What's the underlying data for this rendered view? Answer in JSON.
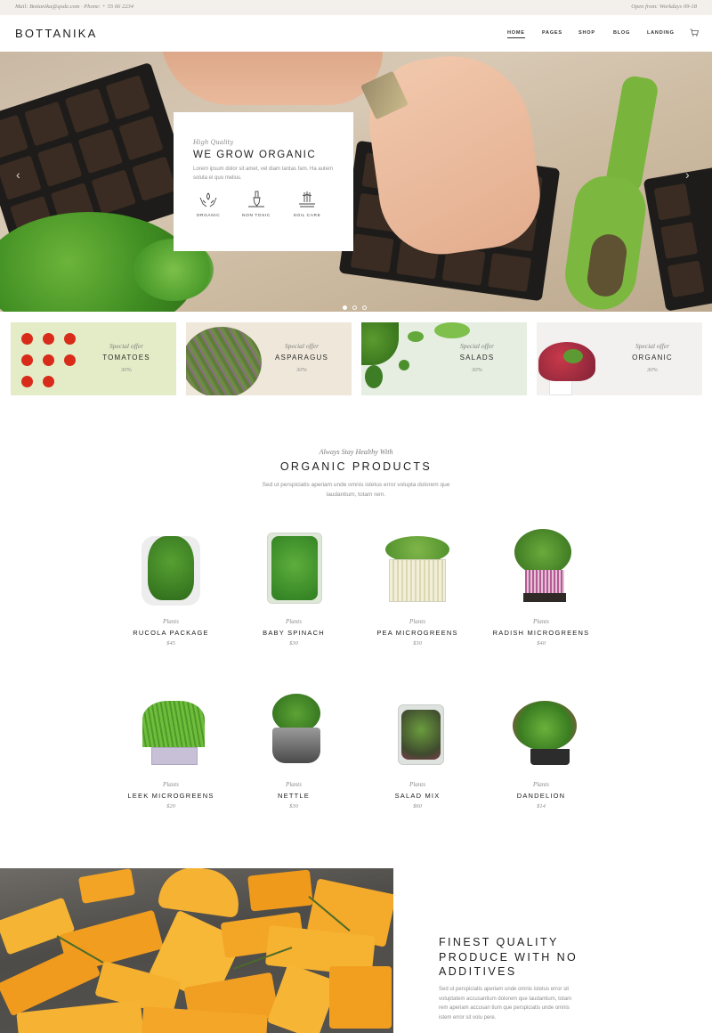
{
  "topbar": {
    "contact": "Mail: Bottanika@qode.com · Phone: + 55 66 2234",
    "hours": "Open from: Workdays 09-18"
  },
  "header": {
    "logo": "BOTTANIKA",
    "nav": [
      "HOME",
      "PAGES",
      "SHOP",
      "BLOG",
      "LANDING"
    ],
    "active_nav": "HOME",
    "cart_icon": "cart-icon"
  },
  "hero": {
    "kicker": "High Quality",
    "title": "WE GROW ORGANIC",
    "description": "Lorem ipsum dolor sit amet, vel diam tantas fam. Ha autem soluta ei quo melius.",
    "features": [
      {
        "label": "ORGANIC",
        "icon": "hands-leaf-icon"
      },
      {
        "label": "NON TOXIC",
        "icon": "shovel-icon"
      },
      {
        "label": "SOIL CARE",
        "icon": "wheat-icon"
      }
    ],
    "slider_count": 3,
    "active_slide": 1
  },
  "offers": [
    {
      "kicker": "Special offer",
      "name": "TOMATOES",
      "percent": "30%",
      "bg": "#e3ecc6"
    },
    {
      "kicker": "Special offer",
      "name": "ASPARAGUS",
      "percent": "30%",
      "bg": "#efe8da"
    },
    {
      "kicker": "Special offer",
      "name": "SALADS",
      "percent": "30%",
      "bg": "#e5eee0"
    },
    {
      "kicker": "Special offer",
      "name": "ORGANIC",
      "percent": "30%",
      "bg": "#f3f1f0"
    }
  ],
  "section": {
    "kicker": "Always Stay Healthy With",
    "title": "ORGANIC PRODUCTS",
    "description": "Sed ut perspiciatis aperiam unde omnis istetus error volupta dolorem que laudantium, totam rem."
  },
  "products": [
    {
      "category": "Plants",
      "name": "RUCOLA PACKAGE",
      "price": "$45"
    },
    {
      "category": "Plants",
      "name": "BABY SPINACH",
      "price": "$30"
    },
    {
      "category": "Plants",
      "name": "PEA MICROGREENS",
      "price": "$30"
    },
    {
      "category": "Plants",
      "name": "RADISH MICROGREENS",
      "price": "$40"
    },
    {
      "category": "Plants",
      "name": "LEEK MICROGREENS",
      "price": "$20"
    },
    {
      "category": "Plants",
      "name": "NETTLE",
      "price": "$30"
    },
    {
      "category": "Plants",
      "name": "SALAD MIX",
      "price": "$60"
    },
    {
      "category": "Plants",
      "name": "DANDELION",
      "price": "$14"
    }
  ],
  "finest": {
    "title": "FINEST QUALITY PRODUCE WITH NO ADDITIVES",
    "description": "Sed ut perspiciatis aperiam unde omnis istetus error sit voluptatem accusantium dolorem que laudantium, totam rem aperiam accusan tium que perspiciatis unde omnis istem error sit volu pere."
  }
}
